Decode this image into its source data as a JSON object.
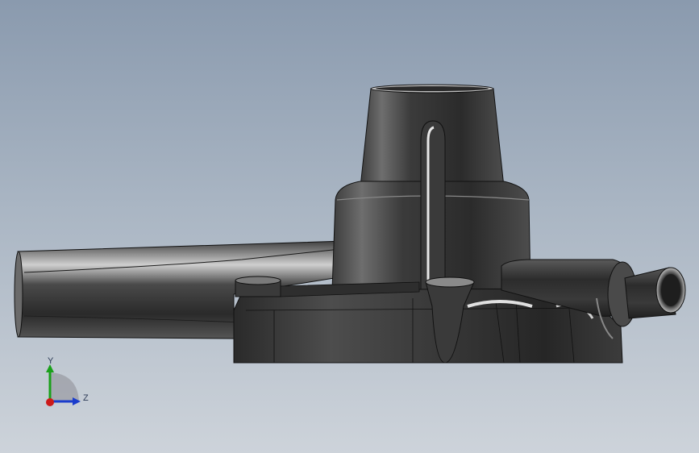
{
  "viewport": {
    "part_colors": {
      "dark": "#2a2a2a",
      "mid": "#4a4a4a",
      "light": "#9a9a9a",
      "highlight": "#f2f2f2",
      "edge": "#111111"
    },
    "background_top": "#8a9aae",
    "background_bottom": "#cdd3da"
  },
  "triad": {
    "y_label": "Y",
    "z_label": "Z",
    "y_color": "#1aa01a",
    "z_color": "#1a3ccc",
    "x_color": "#cc1a1a"
  }
}
